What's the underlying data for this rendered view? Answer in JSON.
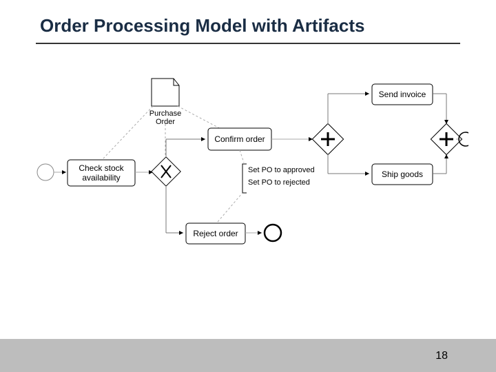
{
  "title": "Order Processing Model with Artifacts",
  "page_number": "18",
  "artifact": {
    "label1": "Purchase",
    "label2": "Order"
  },
  "tasks": {
    "check_stock1": "Check stock",
    "check_stock2": "availability",
    "confirm": "Confirm order",
    "reject": "Reject order",
    "send_invoice": "Send invoice",
    "ship_goods": "Ship goods"
  },
  "annotations": {
    "approved": "Set PO to approved",
    "rejected": "Set PO to rejected"
  }
}
